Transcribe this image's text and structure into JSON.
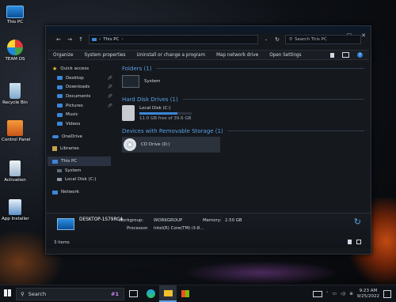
{
  "desktop": {
    "icons": [
      {
        "label": "This PC",
        "icon": "monitor-icon"
      },
      {
        "label": "TEAM OS",
        "icon": "team-os-icon"
      },
      {
        "label": "Recycle Bin",
        "icon": "recycle-bin-icon"
      },
      {
        "label": "Control Panel",
        "icon": "control-panel-icon"
      },
      {
        "label": "Activation",
        "icon": "activation-icon"
      },
      {
        "label": "App Installer",
        "icon": "app-installer-icon"
      }
    ]
  },
  "explorer": {
    "address": "This PC",
    "search_placeholder": "Search This PC",
    "toolbar": {
      "organize": "Organize",
      "system_properties": "System properties",
      "uninstall": "Uninstall or change a program",
      "map_drive": "Map network drive",
      "open_settings": "Open Settings"
    },
    "sidebar": {
      "quick_access": "Quick access",
      "quick_items": [
        {
          "label": "Desktop",
          "pinned": true
        },
        {
          "label": "Downloads",
          "pinned": true
        },
        {
          "label": "Documents",
          "pinned": true
        },
        {
          "label": "Pictures",
          "pinned": true
        },
        {
          "label": "Music",
          "pinned": false
        },
        {
          "label": "Videos",
          "pinned": false
        }
      ],
      "onedrive": "OneDrive",
      "libraries": "Libraries",
      "this_pc": "This PC",
      "pc_items": [
        "System",
        "Local Disk (C:)"
      ],
      "network": "Network"
    },
    "groups": {
      "folders": "Folders (1)",
      "folder_item": "System",
      "hard_disks": "Hard Disk Drives (1)",
      "disk_name": "Local Disk (C:)",
      "disk_free": "11.0 GB free of 39.6 GB",
      "disk_used_fraction": 0.72,
      "removable": "Devices with Removable Storage (1)",
      "cd_drive": "CD Drive (D:)"
    },
    "details": {
      "computer_name": "DESKTOP-1S79RC4",
      "workgroup_label": "Workgroup:",
      "workgroup_value": "WORKGROUP",
      "memory_label": "Memory:",
      "memory_value": "2.50 GB",
      "processor_label": "Processor:",
      "processor_value": "Intel(R) Core(TM) i3-8..."
    },
    "status": "3 items"
  },
  "taskbar": {
    "search_label": "Search",
    "time": "9:23 AM",
    "date": "9/25/2022"
  },
  "colors": {
    "accent": "#3c86d8",
    "group_header": "#5aa2e6",
    "window_bg": "#15181d"
  }
}
